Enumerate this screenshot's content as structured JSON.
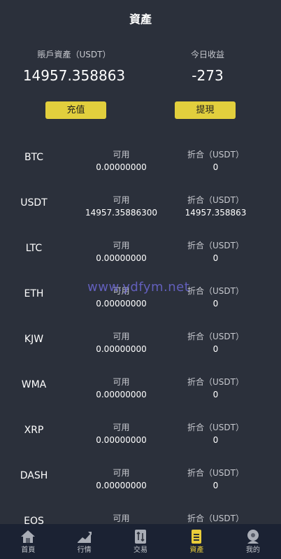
{
  "header": {
    "title": "資產"
  },
  "summary": {
    "account_label": "賬戶資產（USDT）",
    "account_value": "14957.358863",
    "today_label": "今日收益",
    "today_value": "-273"
  },
  "buttons": {
    "deposit": "充值",
    "withdraw": "提現"
  },
  "columns": {
    "available": "可用",
    "converted": "折合（USDT）"
  },
  "assets": [
    {
      "coin": "BTC",
      "available": "0.00000000",
      "converted": "0"
    },
    {
      "coin": "USDT",
      "available": "14957.35886300",
      "converted": "14957.358863"
    },
    {
      "coin": "LTC",
      "available": "0.00000000",
      "converted": "0"
    },
    {
      "coin": "ETH",
      "available": "0.00000000",
      "converted": "0"
    },
    {
      "coin": "KJW",
      "available": "0.00000000",
      "converted": "0"
    },
    {
      "coin": "WMA",
      "available": "0.00000000",
      "converted": "0"
    },
    {
      "coin": "XRP",
      "available": "0.00000000",
      "converted": "0"
    },
    {
      "coin": "DASH",
      "available": "0.00000000",
      "converted": "0"
    },
    {
      "coin": "EOS",
      "available": "",
      "converted": ""
    }
  ],
  "watermark": "www.ydfym.net",
  "tabbar": {
    "items": [
      {
        "label": "首頁",
        "icon": "home-icon"
      },
      {
        "label": "行情",
        "icon": "chart-icon"
      },
      {
        "label": "交易",
        "icon": "exchange-icon"
      },
      {
        "label": "資產",
        "icon": "wallet-icon"
      },
      {
        "label": "我的",
        "icon": "profile-icon"
      }
    ],
    "active_index": 3
  },
  "colors": {
    "background": "#2b303b",
    "accent": "#e2cf3d",
    "tabbar": "#1b2233"
  }
}
